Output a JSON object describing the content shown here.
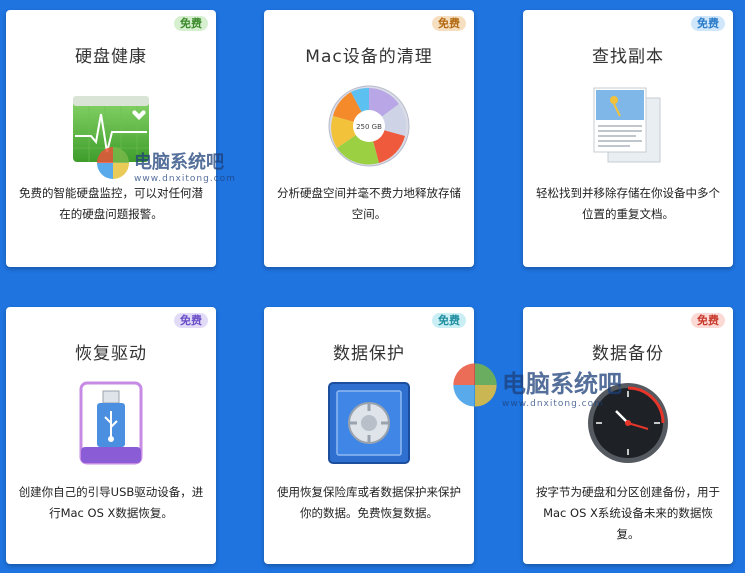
{
  "cards": [
    {
      "title": "硬盘健康",
      "badge": "免费",
      "desc_lines": [
        "免费的智能硬盘监控，可以对任何潜",
        "在的硬盘问题报警。"
      ],
      "icon": "disk-health-icon",
      "badge_bg": "#d6f0cf",
      "badge_fg": "#3c8a2b"
    },
    {
      "title": "Mac设备的清理",
      "badge": "免费",
      "desc_lines": [
        "分析硬盘空间并毫不费力地释放存储",
        "空间。"
      ],
      "icon": "disk-cleanup-icon",
      "disk_label": "250 GB",
      "badge_bg": "#f6dfc0",
      "badge_fg": "#b36a12"
    },
    {
      "title": "查找副本",
      "badge": "免费",
      "desc_lines": [
        "轻松找到并移除存储在你设备中多个",
        "位置的重复文档。"
      ],
      "icon": "duplicates-icon",
      "badge_bg": "#cfe6fb",
      "badge_fg": "#2a7cc9"
    },
    {
      "title": "恢复驱动",
      "badge": "免费",
      "desc_lines": [
        "创建你自己的引导USB驱动设备，进",
        "行Mac OS X数据恢复。"
      ],
      "icon": "usb-drive-icon",
      "badge_bg": "#e1dbf7",
      "badge_fg": "#6b4fc7"
    },
    {
      "title": "数据保护",
      "badge": "免费",
      "desc_lines": [
        "使用恢复保险库或者数据保护来保护",
        "你的数据。免费恢复数据。"
      ],
      "icon": "vault-icon",
      "badge_bg": "#c9eef4",
      "badge_fg": "#1f8ea0"
    },
    {
      "title": "数据备份",
      "badge": "免费",
      "desc_lines": [
        "按字节为硬盘和分区创建备份，用于",
        "Mac OS X系统设备未来的数据恢",
        "复。"
      ],
      "icon": "backup-clock-icon",
      "badge_bg": "#fbd9d5",
      "badge_fg": "#c8392b"
    }
  ],
  "watermarks": [
    {
      "text": "电脑系统吧",
      "url": "www.dnxitong.com"
    },
    {
      "text": "电脑系统吧",
      "url": "www.dnxitong.com"
    }
  ]
}
